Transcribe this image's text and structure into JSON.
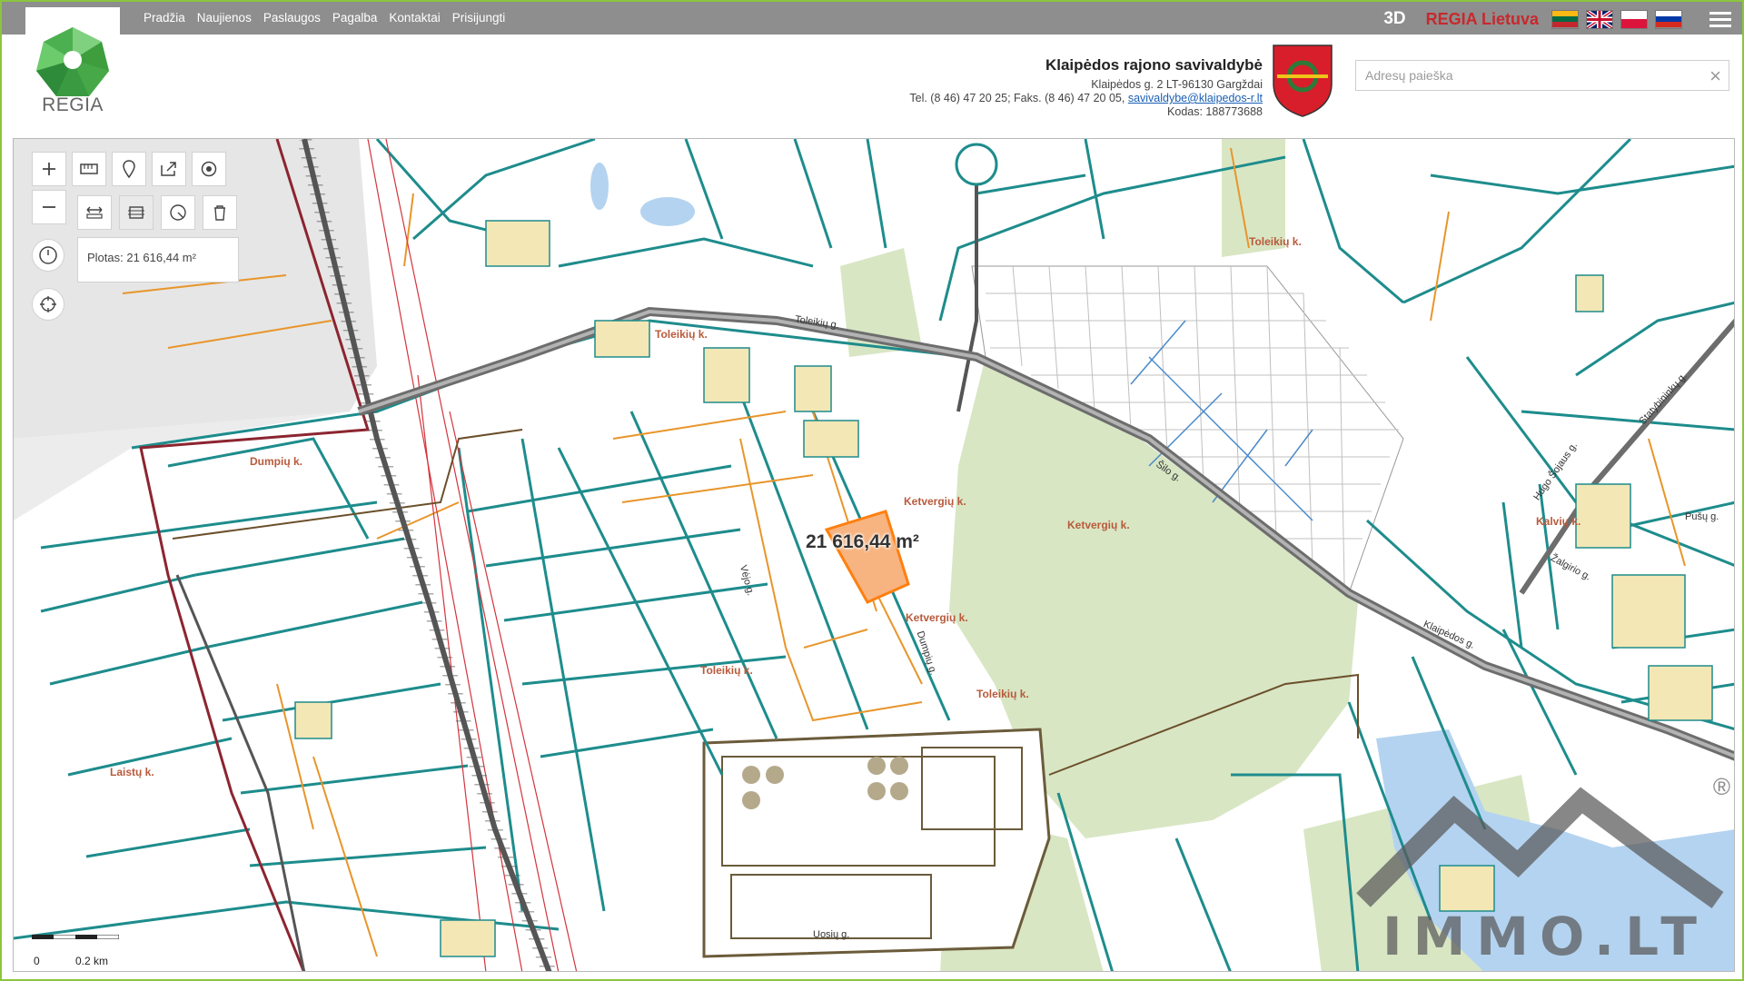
{
  "nav": {
    "items": [
      "Pradžia",
      "Naujienos",
      "Paslaugos",
      "Pagalba",
      "Kontaktai",
      "Prisijungti"
    ],
    "btn_3d": "3D",
    "brand": "REGIA Lietuva",
    "languages": [
      "lt",
      "en",
      "pl",
      "ru"
    ]
  },
  "logo": {
    "text": "REGIA",
    "icon": "regia-gem-icon"
  },
  "org": {
    "name": "Klaipėdos rajono savivaldybė",
    "address": "Klaipėdos g. 2 LT-96130 Gargždai",
    "phones": "Tel. (8 46) 47 20 25; Faks. (8 46) 47 20 05,",
    "email": "savivaldybe@klaipedos-r.lt",
    "code": "Kodas: 188773688"
  },
  "search": {
    "placeholder": "Adresų paieška",
    "value": ""
  },
  "tools": {
    "area_result": "Plotas: 21 616,44 m²"
  },
  "map": {
    "selected_area_label": "21 616,44 m²",
    "places": [
      "Dumpių k.",
      "Toleikių k.",
      "Toleikių k.",
      "Ketvergių k.",
      "Ketvergių k.",
      "Ketvergių k.",
      "Toleikių k.",
      "Toleikių k.",
      "Kalvių k.",
      "Laistų k."
    ],
    "streets": [
      "Toleikių g.",
      "Klaipėdos g.",
      "Uosių g.",
      "Šilo g.",
      "Statybininkų g.",
      "Hugo Šojaus g.",
      "Žalgirio g.",
      "Pušų g.",
      "Dumpių g.",
      "Vėjo g."
    ],
    "scale": {
      "zero": "0",
      "distance": "0.2 km"
    }
  },
  "watermark": {
    "text": "IMMO.LT",
    "registered": "®"
  },
  "colors": {
    "parcel": "#1e8c8c",
    "orange": "#e8952a",
    "forest": "#d8e6c4",
    "selected": "#f7b481",
    "road": "#6d6d6d",
    "nav": "#8e8e8e",
    "brand_red": "#c8282d"
  }
}
